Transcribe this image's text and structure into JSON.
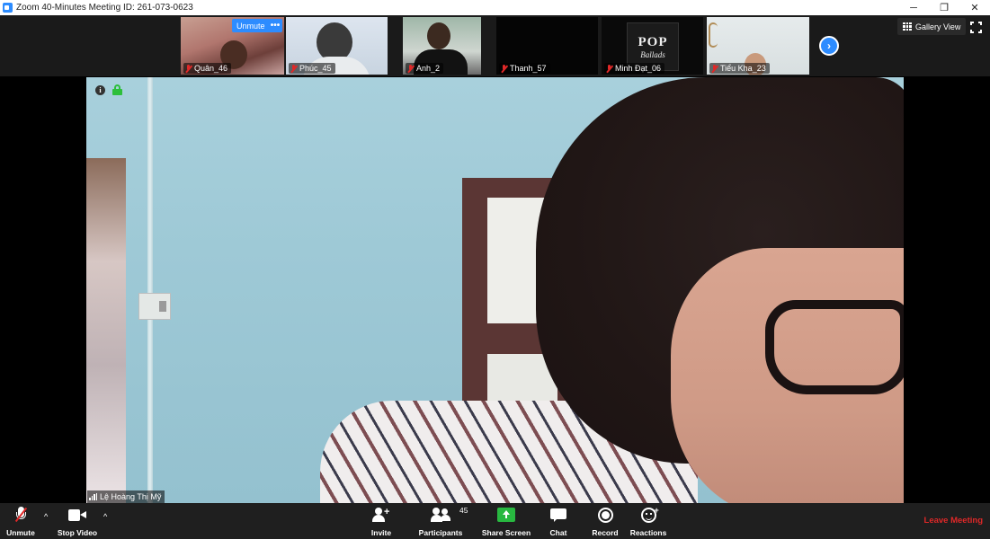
{
  "window": {
    "title": "Zoom 40-Minutes Meeting ID: 261-073-0623",
    "controls": {
      "minimize": "─",
      "restore": "❐",
      "close": "✕"
    }
  },
  "thumbnails": [
    {
      "name": "Quân_46",
      "muted": true
    },
    {
      "name": "Phúc_45",
      "muted": true
    },
    {
      "name": "Anh_2",
      "muted": true
    },
    {
      "name": "Thanh_57",
      "muted": true
    },
    {
      "name": "Minh Đạt_06",
      "muted": true
    },
    {
      "name": "Tiểu Kha_23",
      "muted": true
    }
  ],
  "thumbnail_overlay": {
    "unmute_label": "Unmute",
    "more_label": "•••"
  },
  "album_art": {
    "line1": "POP",
    "line2": "Ballads"
  },
  "next_page_glyph": "›",
  "view": {
    "gallery_label": "Gallery View"
  },
  "main_speaker": {
    "name": "Lệ Hoàng Thị Mỹ"
  },
  "info_glyph": "i",
  "toolbar": {
    "unmute_label": "Unmute",
    "stop_video_label": "Stop Video",
    "invite_label": "Invite",
    "participants_label": "Participants",
    "participants_count": "45",
    "share_screen_label": "Share Screen",
    "chat_label": "Chat",
    "record_label": "Record",
    "reactions_label": "Reactions",
    "leave_label": "Leave Meeting",
    "caret_glyph": "^",
    "plus_glyph": "+"
  },
  "colors": {
    "accent": "#2d8cff",
    "danger": "#e02828",
    "share_green": "#28b840",
    "lock_green": "#2dbf3a",
    "toolbar_bg": "#1f1f1f"
  },
  "icons": [
    "zoom-app-icon",
    "mic-muted-icon",
    "camera-icon",
    "invite-icon",
    "participants-icon",
    "share-screen-icon",
    "chat-icon",
    "record-icon",
    "reactions-icon",
    "grid-icon",
    "fullscreen-icon",
    "info-icon",
    "lock-icon",
    "signal-icon",
    "chevron-right-icon"
  ]
}
